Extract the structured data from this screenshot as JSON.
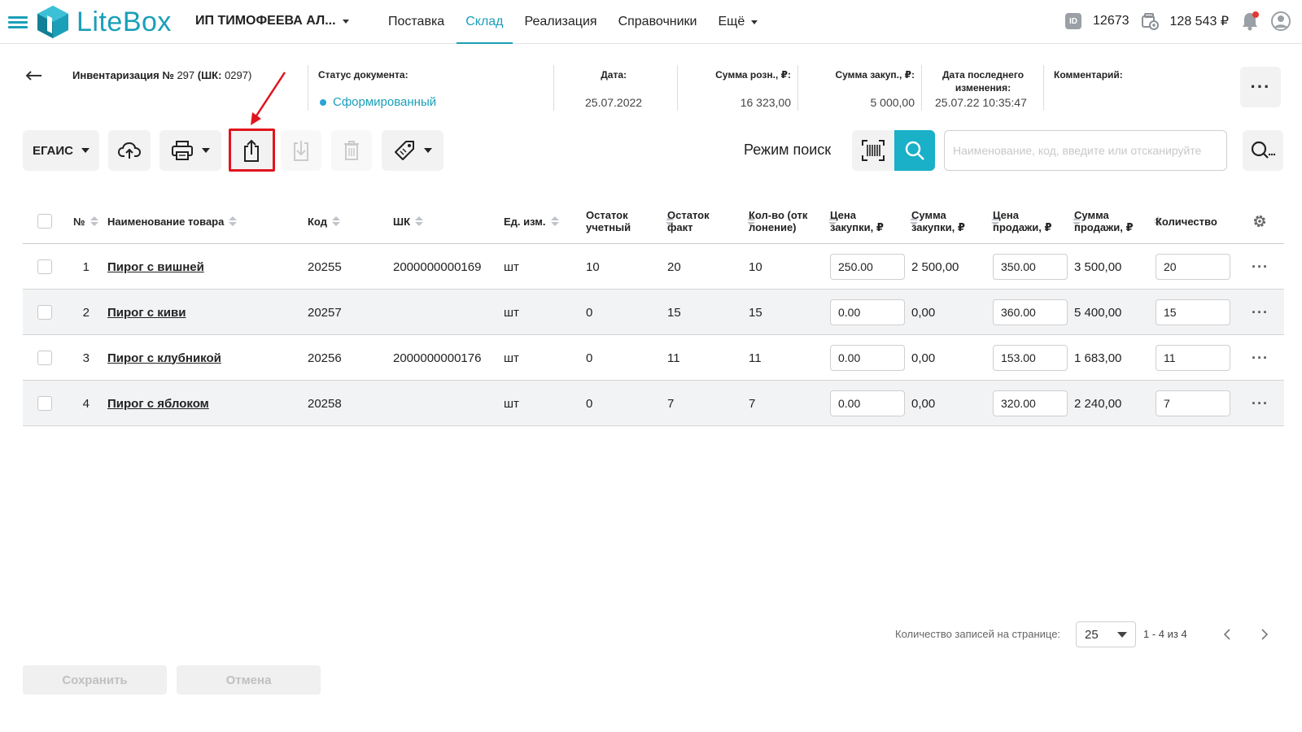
{
  "app": {
    "logo_text": "LiteBox",
    "org_name": "ИП ТИМОФЕЕВА АЛ...",
    "nav": [
      {
        "label": "Поставка"
      },
      {
        "label": "Склад"
      },
      {
        "label": "Реализация"
      },
      {
        "label": "Справочники"
      },
      {
        "label": "Ещё"
      }
    ],
    "active_nav": "Склад",
    "id_badge": "ID",
    "user_id": "12673",
    "balance": "128 543 ₽",
    "accent_color": "#1a9fb8"
  },
  "document": {
    "title_bold": "Инвентаризация №",
    "title_number": "297",
    "title_code_label": "(ШК:",
    "title_code": "0297)",
    "status_label": "Статус документа:",
    "status_value": "Сформированный",
    "date_label": "Дата:",
    "date_value": "25.07.2022",
    "retail_sum_label": "Сумма розн., ₽:",
    "retail_sum_value": "16 323,00",
    "purchase_sum_label": "Сумма закуп., ₽:",
    "purchase_sum_value": "5 000,00",
    "last_change_label": "Дата последнего изменения:",
    "last_change_value": "25.07.22 10:35:47",
    "comment_label": "Комментарий:"
  },
  "toolbar": {
    "egais_label": "ЕГАИС",
    "mode_label": "Режим поиск",
    "search_placeholder": "Наименование, код, введите или отсканируйте"
  },
  "table": {
    "headers": {
      "num": "№",
      "name": "Наименование товара",
      "code": "Код",
      "barcode": "ШК",
      "unit": "Ед. изм.",
      "stock_acc": "Остаток учетный",
      "stock_fact": "Остаток факт",
      "deviation": "Кол-во (отклонение)",
      "purchase_price": "Цена закупки, ₽",
      "purchase_sum": "Сумма закупки, ₽",
      "sale_price": "Цена продажи, ₽",
      "sale_sum": "Сумма продажи, ₽",
      "qty": "Количество"
    },
    "rows": [
      {
        "num": "1",
        "name": "Пирог с вишней",
        "code": "20255",
        "barcode": "2000000000169",
        "unit": "шт",
        "stock_acc": "10",
        "stock_fact": "20",
        "deviation": "10",
        "purchase_price": "250.00",
        "purchase_sum": "2 500,00",
        "sale_price": "350.00",
        "sale_sum": "3 500,00",
        "qty": "20"
      },
      {
        "num": "2",
        "name": "Пирог с киви",
        "code": "20257",
        "barcode": "",
        "unit": "шт",
        "stock_acc": "0",
        "stock_fact": "15",
        "deviation": "15",
        "purchase_price": "0.00",
        "purchase_sum": "0,00",
        "sale_price": "360.00",
        "sale_sum": "5 400,00",
        "qty": "15"
      },
      {
        "num": "3",
        "name": "Пирог с клубникой",
        "code": "20256",
        "barcode": "2000000000176",
        "unit": "шт",
        "stock_acc": "0",
        "stock_fact": "11",
        "deviation": "11",
        "purchase_price": "0.00",
        "purchase_sum": "0,00",
        "sale_price": "153.00",
        "sale_sum": "1 683,00",
        "qty": "11"
      },
      {
        "num": "4",
        "name": "Пирог с яблоком",
        "code": "20258",
        "barcode": "",
        "unit": "шт",
        "stock_acc": "0",
        "stock_fact": "7",
        "deviation": "7",
        "purchase_price": "0.00",
        "purchase_sum": "0,00",
        "sale_price": "320.00",
        "sale_sum": "2 240,00",
        "qty": "7"
      }
    ]
  },
  "pagination": {
    "per_page_label": "Количество записей на странице:",
    "per_page_value": "25",
    "range": "1 - 4 из 4"
  },
  "footer": {
    "save_label": "Сохранить",
    "cancel_label": "Отмена"
  }
}
